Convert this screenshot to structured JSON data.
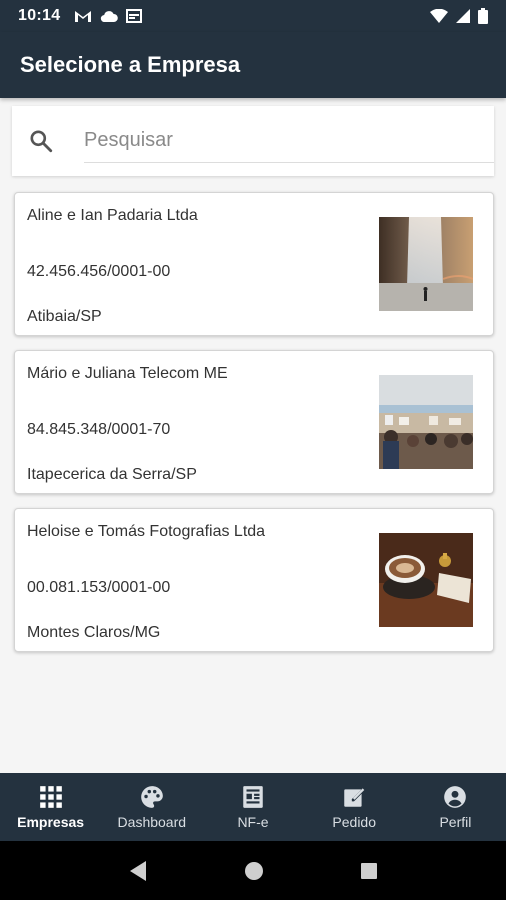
{
  "statusbar": {
    "time": "10:14",
    "left_icons": [
      "gmail-icon",
      "cloud-icon",
      "calendar-icon"
    ],
    "right_icons": [
      "wifi-icon",
      "signal-icon",
      "battery-icon"
    ]
  },
  "appbar": {
    "title": "Selecione a Empresa"
  },
  "search": {
    "placeholder": "Pesquisar",
    "value": ""
  },
  "companies": [
    {
      "name": "Aline e Ian Padaria Ltda",
      "cnpj": "42.456.456/0001-00",
      "city": "Atibaia/SP",
      "image": "waterfall-photo"
    },
    {
      "name": "Mário e Juliana Telecom ME",
      "cnpj": "84.845.348/0001-70",
      "city": "Itapecerica da Serra/SP",
      "image": "crowd-city-photo"
    },
    {
      "name": "Heloise e Tomás Fotografias Ltda",
      "cnpj": "00.081.153/0001-00",
      "city": "Montes Claros/MG",
      "image": "coffee-cup-photo"
    }
  ],
  "bottom_nav": [
    {
      "label": "Empresas",
      "icon": "grid-icon",
      "active": true
    },
    {
      "label": "Dashboard",
      "icon": "palette-icon",
      "active": false
    },
    {
      "label": "NF-e",
      "icon": "document-icon",
      "active": false
    },
    {
      "label": "Pedido",
      "icon": "edit-icon",
      "active": false
    },
    {
      "label": "Perfil",
      "icon": "account-icon",
      "active": false
    }
  ],
  "colors": {
    "primary": "#24323f",
    "background": "#f5f5f5",
    "card": "#ffffff"
  }
}
